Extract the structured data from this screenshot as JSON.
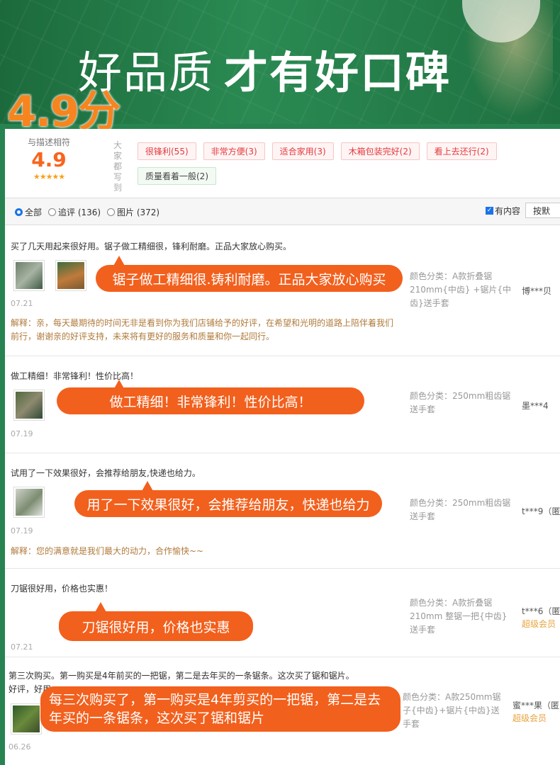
{
  "banner": {
    "slogan_thin": "好品质",
    "slogan_bold": "才有好口碑",
    "score_big": "4.9分"
  },
  "summary": {
    "label": "与描述相符",
    "score": "4.9",
    "stars": "★★★★★",
    "vertical_label": "大家都写到",
    "tags": [
      {
        "text": "很锋利(55)",
        "style": "red"
      },
      {
        "text": "非常方便(3)",
        "style": "red"
      },
      {
        "text": "适合家用(3)",
        "style": "red"
      },
      {
        "text": "木箱包装完好(2)",
        "style": "red"
      },
      {
        "text": "看上去还行(2)",
        "style": "red"
      },
      {
        "text": "质量看着一般(2)",
        "style": "green"
      }
    ]
  },
  "filter": {
    "all": "全部",
    "followup": "追评 (136)",
    "pictures": "图片 (372)",
    "has_content": "有内容",
    "sort": "按默"
  },
  "reviews": [
    {
      "text": "买了几天用起来很好用。锯子做工精细很，锋利耐磨。正品大家放心购买。",
      "date": "07.21",
      "sku": "颜色分类：A款折叠锯210mm{中齿} +锯片{中齿}送手套",
      "user": "博***贝",
      "reply": "解释：亲，每天最期待的时间无非是看到你为我们店铺给予的好评，在希望和光明的道路上陪伴着我们前行，谢谢亲的好评支持，未来将有更好的服务和质量和你一起同行。",
      "bubble": "锯子做工精细很.铸利耐磨。正品大家放心购买"
    },
    {
      "text": "做工精细！非常锋利！性价比高！",
      "date": "07.19",
      "sku": "颜色分类：250mm粗齿锯 送手套",
      "user": "墨***4",
      "bubble": "做工精细！非常锋利！性价比高！"
    },
    {
      "text": "试用了一下效果很好，会推荐给朋友,快递也给力。",
      "date": "07.19",
      "sku": "颜色分类：250mm粗齿锯 送手套",
      "user": "t***9（匿",
      "reply": "解释：您的满意就是我们最大的动力，合作愉快~~",
      "bubble": "用了一下效果很好，会推荐给朋友，快递也给力"
    },
    {
      "text": "刀锯很好用，价格也实惠！",
      "date": "07.21",
      "sku": "颜色分类：A款折叠锯210mm 整锯一把{中齿}送手套",
      "user": "t***6（匿",
      "vip": "超级会员",
      "bubble": "刀锯很好用，价格也实惠"
    },
    {
      "text": "第三次购买。第一购买是4年前买的一把锯，第二是去年买的一条锯条。这次买了锯和锯片。",
      "text2": "好评，好用",
      "date": "06.26",
      "sku": "颜色分类：A款250mm锯子{中齿}+锯片{中齿}送手套",
      "user": "蜜***果（匿",
      "vip": "超级会员",
      "bubble": "每三次购买了，第一购买是4年剪买的一把锯，第二是去年买的一条锯条，这次买了锯和锯片"
    }
  ]
}
